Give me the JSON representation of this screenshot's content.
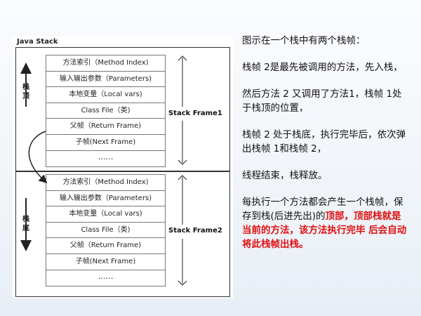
{
  "diagram": {
    "title": "Java Stack",
    "top_label": "栈\n顶",
    "bottom_label": "栈\n底",
    "frames": [
      {
        "label": "Stack Frame1",
        "rows": [
          "方法索引（Method Index)",
          "输入输出参数（Parameters)",
          "本地变量（Local vars)",
          "Class File（类)",
          "父帧（Return Frame)",
          "子帧(Next Frame)",
          "……"
        ]
      },
      {
        "label": "Stack Frame2",
        "rows": [
          "方法索引（Method Index)",
          "输入输出参数（Parameters)",
          "本地变量（Local vars)",
          "Class File（类)",
          "父帧（Return Frame)",
          "子帧(Next Frame)",
          "……"
        ]
      }
    ]
  },
  "text": {
    "p1": "图示在一个栈中有两个栈帧：",
    "p2": "栈帧 2是最先被调用的方法，先入栈，",
    "p3": "然后方法 2 又调用了方法1，栈帧 1处于栈顶的位置，",
    "p4": "栈帧 2 处于栈底，执行完毕后，依次弹出栈帧 1和栈帧 2，",
    "p5": "线程结束，栈释放。",
    "p6_normal": "每执行一个方法都会产生一个栈帧，保存到栈(后进先出)的",
    "p6_red": "顶部，顶部栈就是当前的方法，该方法执行完毕 后会自动将此栈帧出栈。"
  },
  "colors": {
    "highlight": "#e01010"
  }
}
